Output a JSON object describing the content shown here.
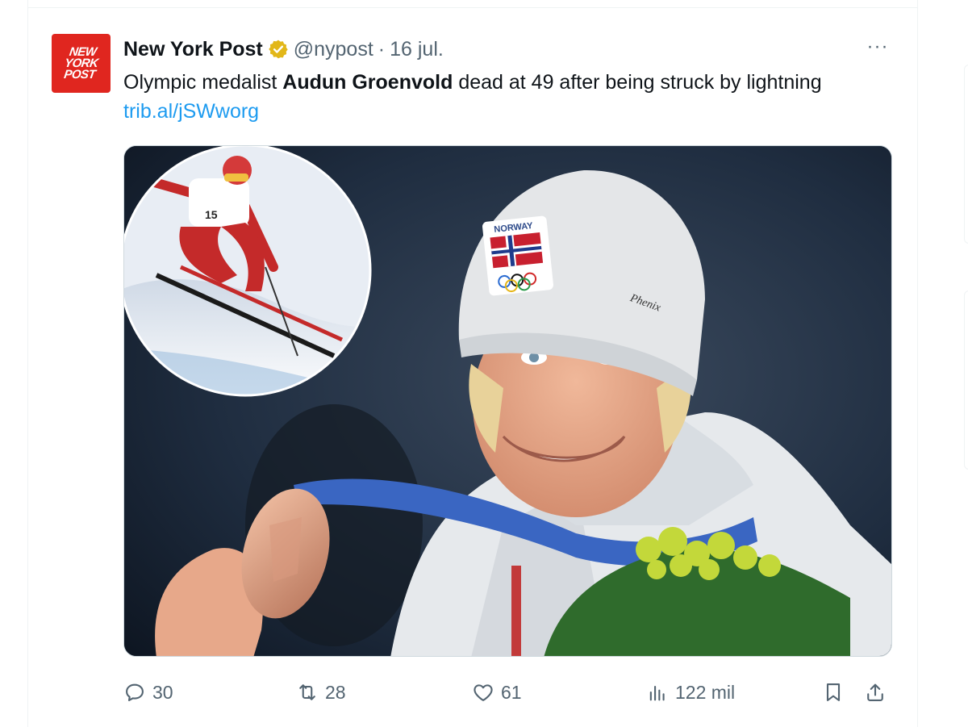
{
  "tweet": {
    "author_name": "New York Post",
    "handle": "@nypost",
    "separator": "·",
    "date": "16 jul.",
    "more_label": "···",
    "text_before": "Olympic medalist ",
    "text_bold": "Audun Groenvold",
    "text_after": " dead at 49 after being struck by lightning ",
    "link": "trib.al/jSWworg",
    "avatar_lines": [
      "NEW",
      "YORK",
      "POST"
    ],
    "media_texts": {
      "hat_country": "NORWAY",
      "hat_brand": "Phenix",
      "bib_number": "15"
    }
  },
  "actions": {
    "replies": "30",
    "reposts": "28",
    "likes": "61",
    "views": "122 mil"
  },
  "icons": [
    "verified-badge-icon",
    "more-icon",
    "reply-icon",
    "repost-icon",
    "like-icon",
    "views-icon",
    "bookmark-icon",
    "share-icon"
  ],
  "colors": {
    "link": "#1d9bf0",
    "muted": "#536471",
    "brand_red": "#e0261f",
    "verified_gold": "#e2b719"
  }
}
